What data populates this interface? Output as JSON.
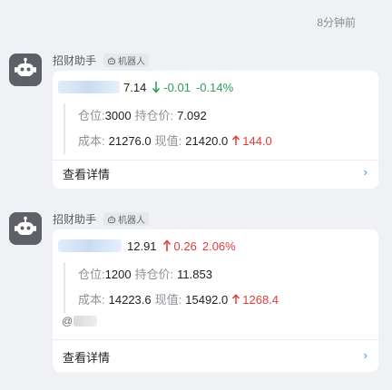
{
  "timestamp": "8分钟前",
  "messages": [
    {
      "sender": "招财助手",
      "bot_tag": "机器人",
      "stock": {
        "price": "7.14",
        "change": "-0.01",
        "change_pct": "-0.14%",
        "direction": "down"
      },
      "position": {
        "qty_label": "仓位:",
        "qty": "3000",
        "cost_price_label": "持仓价:",
        "cost_price": "7.092",
        "cost_label": "成本:",
        "cost": "21276.0",
        "value_label": "现值:",
        "value": "21420.0",
        "pnl": "144.0",
        "pnl_direction": "up"
      },
      "detail_label": "查看详情",
      "chevron": "›"
    },
    {
      "sender": "招财助手",
      "bot_tag": "机器人",
      "stock": {
        "price": "12.91",
        "change": "0.26",
        "change_pct": "2.06%",
        "direction": "up"
      },
      "position": {
        "qty_label": "仓位:",
        "qty": "1200",
        "cost_price_label": "持仓价:",
        "cost_price": "11.853",
        "cost_label": "成本:",
        "cost": "14223.6",
        "value_label": "现值:",
        "value": "15492.0",
        "pnl": "1268.4",
        "pnl_direction": "up"
      },
      "mention": "@",
      "detail_label": "查看详情",
      "chevron": "›"
    }
  ],
  "colors": {
    "up": "#e23a3a",
    "down": "#2aa05a",
    "link": "#4b8fe8"
  }
}
